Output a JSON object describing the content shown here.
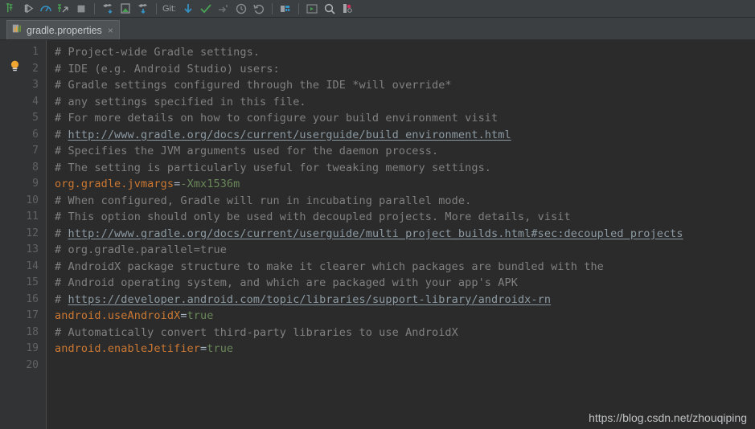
{
  "toolbar": {
    "items": [
      {
        "name": "update-project-icon",
        "title": "Update Project"
      },
      {
        "name": "run-icon",
        "title": "Run"
      },
      {
        "name": "profile-icon",
        "title": "Profile"
      },
      {
        "name": "debug-icon",
        "title": "Debug"
      },
      {
        "name": "stop-icon",
        "title": "Stop"
      },
      {
        "name": "sync-project-icon",
        "title": "Sync Project with Gradle Files"
      },
      {
        "name": "avd-manager-icon",
        "title": "AVD Manager"
      },
      {
        "name": "sdk-manager-icon",
        "title": "SDK Manager"
      }
    ],
    "vcs_label": "Git:",
    "vcs_items": [
      {
        "name": "vcs-update-icon",
        "title": "Update Project"
      },
      {
        "name": "vcs-commit-icon",
        "title": "Commit"
      },
      {
        "name": "vcs-push-icon",
        "title": "Push"
      },
      {
        "name": "vcs-history-icon",
        "title": "Show History"
      },
      {
        "name": "vcs-rollback-icon",
        "title": "Rollback"
      }
    ],
    "right_items": [
      {
        "name": "layout-editor-icon",
        "title": "Layout Editor"
      },
      {
        "name": "run-anything-icon",
        "title": "Run Anything"
      },
      {
        "name": "search-icon",
        "title": "Search Everywhere"
      },
      {
        "name": "theme-icon",
        "title": "Theme"
      }
    ]
  },
  "tab": {
    "filename": "gradle.properties",
    "icon": "properties-file-icon",
    "close": "×"
  },
  "editor": {
    "line_numbers": [
      "1",
      "2",
      "3",
      "4",
      "5",
      "6",
      "7",
      "8",
      "9",
      "10",
      "11",
      "12",
      "13",
      "14",
      "15",
      "16",
      "17",
      "18",
      "19",
      "20"
    ],
    "intention_icon": "lightbulb-icon",
    "lines": [
      {
        "n": 1,
        "type": "comment",
        "text": "# Project-wide Gradle settings."
      },
      {
        "n": 2,
        "type": "comment",
        "text": "# IDE (e.g. Android Studio) users:"
      },
      {
        "n": 3,
        "type": "comment",
        "text": "# Gradle settings configured through the IDE *will override*"
      },
      {
        "n": 4,
        "type": "comment",
        "text": "# any settings specified in this file."
      },
      {
        "n": 5,
        "type": "comment",
        "text": "# For more details on how to configure your build environment visit"
      },
      {
        "n": 6,
        "type": "comment-link",
        "prefix": "# ",
        "link": "http://www.gradle.org/docs/current/userguide/build_environment.html"
      },
      {
        "n": 7,
        "type": "comment",
        "text": "# Specifies the JVM arguments used for the daemon process."
      },
      {
        "n": 8,
        "type": "comment",
        "text": "# The setting is particularly useful for tweaking memory settings."
      },
      {
        "n": 9,
        "type": "property",
        "key": "org.gradle.jvmargs",
        "eq": "=",
        "value": "-Xmx1536m"
      },
      {
        "n": 10,
        "type": "comment",
        "text": "# When configured, Gradle will run in incubating parallel mode."
      },
      {
        "n": 11,
        "type": "comment",
        "text": "# This option should only be used with decoupled projects. More details, visit"
      },
      {
        "n": 12,
        "type": "comment-link",
        "prefix": "# ",
        "link": "http://www.gradle.org/docs/current/userguide/multi_project_builds.html#sec:decoupled_projects"
      },
      {
        "n": 13,
        "type": "comment",
        "text": "# org.gradle.parallel=true"
      },
      {
        "n": 14,
        "type": "comment",
        "text": "# AndroidX package structure to make it clearer which packages are bundled with the"
      },
      {
        "n": 15,
        "type": "comment",
        "text": "# Android operating system, and which are packaged with your app's APK"
      },
      {
        "n": 16,
        "type": "comment-link",
        "prefix": "# ",
        "link": "https://developer.android.com/topic/libraries/support-library/androidx-rn"
      },
      {
        "n": 17,
        "type": "property",
        "key": "android.useAndroidX",
        "eq": "=",
        "value": "true"
      },
      {
        "n": 18,
        "type": "comment",
        "text": "# Automatically convert third-party libraries to use AndroidX"
      },
      {
        "n": 19,
        "type": "property",
        "key": "android.enableJetifier",
        "eq": "=",
        "value": "true"
      },
      {
        "n": 20,
        "type": "empty",
        "text": ""
      }
    ]
  },
  "watermark": {
    "text": "https://blog.csdn.net/zhouqiping"
  },
  "colors": {
    "editor_bg": "#2b2b2b",
    "gutter_bg": "#313335",
    "chrome_bg": "#3c3f41",
    "comment": "#808080",
    "key": "#cc7832",
    "value": "#6a8759",
    "link": "#8c9aa3",
    "accent_green": "#499c54",
    "accent_blue": "#3592c4"
  }
}
